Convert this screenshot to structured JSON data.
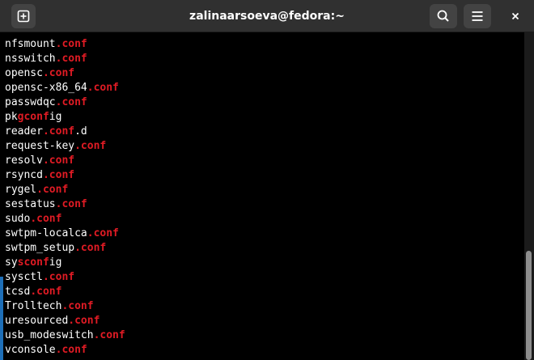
{
  "window": {
    "title": "zalinaarsoeva@fedora:~"
  },
  "titlebar": {
    "new_tab_icon": "plus-in-square-icon",
    "search_icon": "search-icon",
    "menu_icon": "hamburger-menu-icon",
    "close_icon": "close-icon"
  },
  "terminal": {
    "highlight_color": "#e01b24",
    "text_color": "#ffffff",
    "lines": [
      [
        {
          "t": "nfsmount",
          "h": false
        },
        {
          "t": ".conf",
          "h": true
        }
      ],
      [
        {
          "t": "nsswitch",
          "h": false
        },
        {
          "t": ".conf",
          "h": true
        }
      ],
      [
        {
          "t": "opensc",
          "h": false
        },
        {
          "t": ".conf",
          "h": true
        }
      ],
      [
        {
          "t": "opensc-x86_64",
          "h": false
        },
        {
          "t": ".conf",
          "h": true
        }
      ],
      [
        {
          "t": "passwdqc",
          "h": false
        },
        {
          "t": ".conf",
          "h": true
        }
      ],
      [
        {
          "t": "pk",
          "h": false
        },
        {
          "t": "gconf",
          "h": true
        },
        {
          "t": "ig",
          "h": false
        }
      ],
      [
        {
          "t": "reader",
          "h": false
        },
        {
          "t": ".conf",
          "h": true
        },
        {
          "t": ".d",
          "h": false
        }
      ],
      [
        {
          "t": "request-key",
          "h": false
        },
        {
          "t": ".conf",
          "h": true
        }
      ],
      [
        {
          "t": "resolv",
          "h": false
        },
        {
          "t": ".conf",
          "h": true
        }
      ],
      [
        {
          "t": "rsyncd",
          "h": false
        },
        {
          "t": ".conf",
          "h": true
        }
      ],
      [
        {
          "t": "rygel",
          "h": false
        },
        {
          "t": ".conf",
          "h": true
        }
      ],
      [
        {
          "t": "sestatus",
          "h": false
        },
        {
          "t": ".conf",
          "h": true
        }
      ],
      [
        {
          "t": "sudo",
          "h": false
        },
        {
          "t": ".conf",
          "h": true
        }
      ],
      [
        {
          "t": "swtpm-localca",
          "h": false
        },
        {
          "t": ".conf",
          "h": true
        }
      ],
      [
        {
          "t": "swtpm_setup",
          "h": false
        },
        {
          "t": ".conf",
          "h": true
        }
      ],
      [
        {
          "t": "sy",
          "h": false
        },
        {
          "t": "sconf",
          "h": true
        },
        {
          "t": "ig",
          "h": false
        }
      ],
      [
        {
          "t": "sysctl",
          "h": false
        },
        {
          "t": ".conf",
          "h": true
        }
      ],
      [
        {
          "t": "tcsd",
          "h": false
        },
        {
          "t": ".conf",
          "h": true
        }
      ],
      [
        {
          "t": "Trolltech",
          "h": false
        },
        {
          "t": ".conf",
          "h": true
        }
      ],
      [
        {
          "t": "uresourced",
          "h": false
        },
        {
          "t": ".conf",
          "h": true
        }
      ],
      [
        {
          "t": "usb_modeswitch",
          "h": false
        },
        {
          "t": ".conf",
          "h": true
        }
      ],
      [
        {
          "t": "vconsole",
          "h": false
        },
        {
          "t": ".conf",
          "h": true
        }
      ]
    ]
  }
}
